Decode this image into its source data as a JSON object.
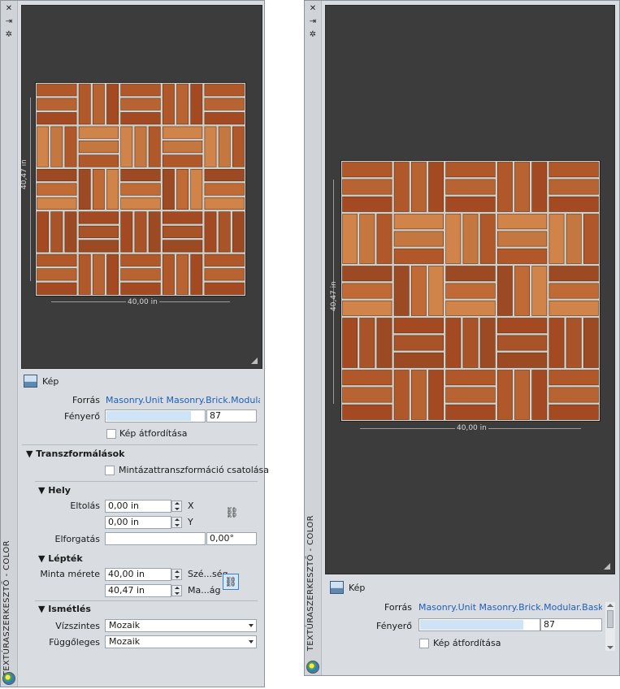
{
  "title": "TEXTÚRASZERKESZTŐ - COLOR",
  "icons": {
    "close": "close-icon",
    "autohide": "autohide-icon",
    "properties": "gear-icon",
    "palette": "palette-icon",
    "image": "image-icon",
    "link": "link-chain-icon"
  },
  "controls": {
    "close_glyph": "✕",
    "autohide_glyph": "⇥",
    "properties_glyph": "✲",
    "link_glyph": "⛓"
  },
  "preview": {
    "width_label": "40,00 in",
    "height_label": "40,47 in"
  },
  "image_section": {
    "header": "Kép",
    "source_label": "Forrás",
    "source_value_left": "Masonry.Unit Masonry.Brick.Modular.",
    "source_value_right": "Masonry.Unit Masonry.Brick.Modular.Bask",
    "brightness_label": "Fényerő",
    "brightness_value": "87",
    "brightness_fraction": 0.87,
    "invert_label": "Kép átfordítása",
    "invert_checked": false
  },
  "transforms": {
    "header": "Transzformálások",
    "link_label": "Mintázattranszformáció csatolása",
    "link_checked": false,
    "position": {
      "header": "Hely",
      "offset_label": "Eltolás",
      "offset_x": "0,00 in",
      "offset_y": "0,00 in",
      "x_label": "X",
      "y_label": "Y",
      "rotation_label": "Elforgatás",
      "rotation_value": "0,00°"
    },
    "scale": {
      "header": "Lépték",
      "sample_size_label": "Minta mérete",
      "width_value": "40,00 in",
      "height_value": "40,47 in",
      "width_label": "Szé...ség",
      "height_label": "Ma...ág"
    },
    "repeat": {
      "header": "Ismétlés",
      "horizontal_label": "Vízszintes",
      "horizontal_value": "Mozaik",
      "vertical_label": "Függőleges",
      "vertical_value": "Mozaik"
    }
  },
  "colors": {
    "panel_bg": "#d9dde1",
    "preview_bg": "#3c3c3c",
    "link_text": "#1d5fb8",
    "brick": "#a9542a"
  }
}
